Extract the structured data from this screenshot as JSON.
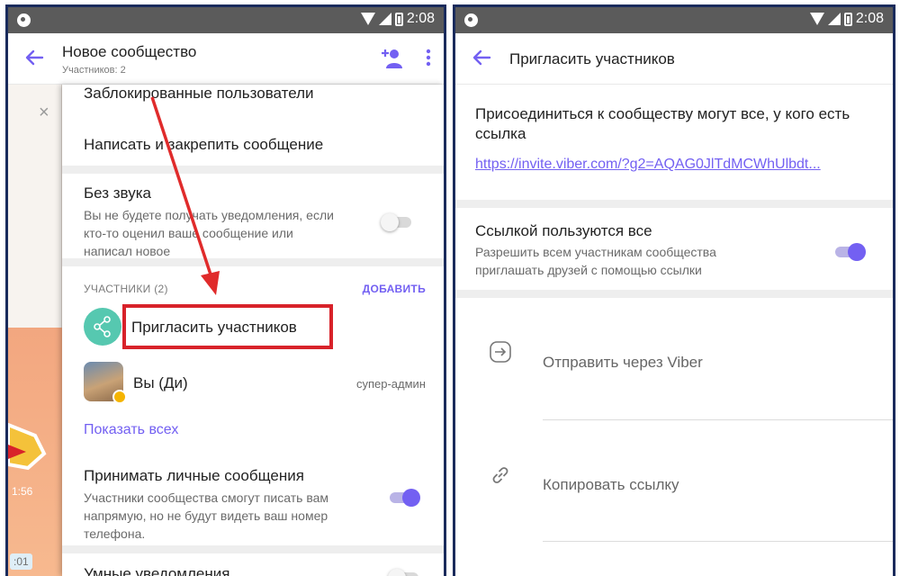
{
  "status_bar": {
    "time": "2:08"
  },
  "left": {
    "title": "Новое сообщество",
    "subtitle": "Участников: 2",
    "background_chat": {
      "time1": "1:56",
      "time2": ":01"
    },
    "rows": {
      "blocked_users": "Заблокированные пользователи",
      "pin_message": "Написать и закрепить сообщение",
      "mute_title": "Без звука",
      "mute_desc": "Вы не будете получать уведомления, если кто-то оценил ваше сообщение или написал новое",
      "participants_label": "УЧАСТНИКИ (2)",
      "add_action": "ДОБАВИТЬ",
      "invite": "Пригласить участников",
      "member_name": "Вы (Ди)",
      "member_role": "супер-админ",
      "show_all": "Показать всех",
      "pm_title": "Принимать личные сообщения",
      "pm_desc": "Участники сообщества смогут писать вам напрямую, но не будут видеть ваш номер телефона.",
      "smart_title": "Умные уведомления"
    },
    "toggles": {
      "mute": "off",
      "private_messages": "on",
      "smart": "off"
    }
  },
  "right": {
    "title": "Пригласить участников",
    "join_text": "Присоединиться к сообществу могут все, у кого есть ссылка",
    "link": "https://invite.viber.com/?g2=AQAG0JlTdMCWhUlbdt...",
    "share_title": "Ссылкой пользуются все",
    "share_desc": "Разрешить всем участникам сообщества приглашать друзей с помощью ссылки",
    "share_toggle": "on",
    "options": [
      "Отправить через Viber",
      "Копировать ссылку"
    ]
  },
  "colors": {
    "accent": "#7360f2",
    "highlight": "#d8222a",
    "teal": "#56c8b0",
    "border": "#1a2b5c"
  }
}
